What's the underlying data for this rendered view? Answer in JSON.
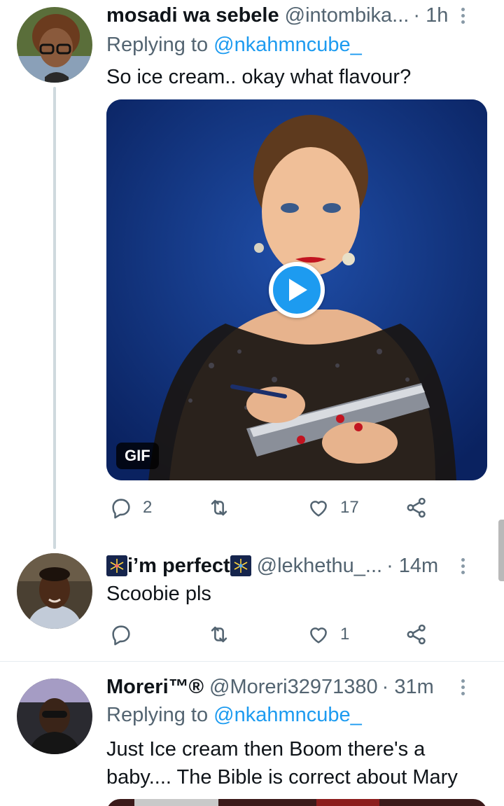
{
  "tweets": [
    {
      "name": "mosadi wa sebele",
      "handle": "@intombika...",
      "time": "· 1h",
      "replying_prefix": "Replying to",
      "replying_to": "@nkahmncube_",
      "text": "So ice cream.. okay what flavour?",
      "media_badge": "GIF",
      "actions": {
        "reply_count": "2",
        "retweet_count": "",
        "like_count": "17"
      }
    },
    {
      "name_emoji_left": "fireworks-emoji",
      "name": "i’m perfect",
      "name_emoji_right": "fireworks-emoji",
      "handle": "@lekhethu_...",
      "time": "· 14m",
      "text": "Scoobie pls",
      "actions": {
        "reply_count": "",
        "retweet_count": "",
        "like_count": "1"
      }
    },
    {
      "name": "Moreri™®",
      "handle": "@Moreri32971380",
      "time": "· 31m",
      "replying_prefix": "Replying to",
      "replying_to": "@nkahmncube_",
      "text_line1": "Just Ice cream then Boom there's a",
      "text_line2": "baby.... The Bible is correct about Mary"
    }
  ],
  "colors": {
    "link": "#1d9bf0",
    "muted": "#536471",
    "text": "#0f1419",
    "thread_line": "#cfd9de"
  }
}
